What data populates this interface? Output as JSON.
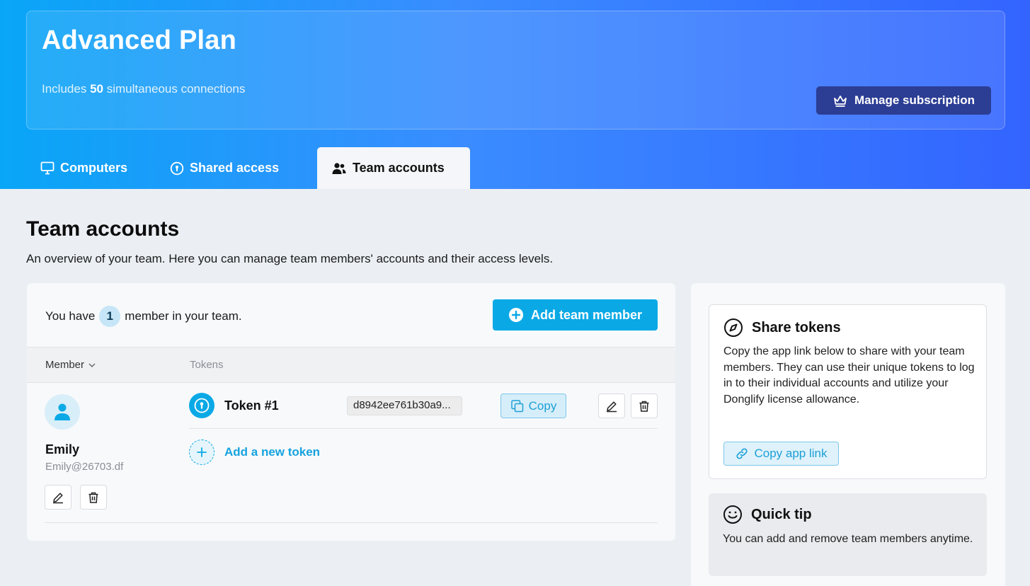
{
  "plan": {
    "title": "Advanced Plan",
    "sub_prefix": "Includes",
    "connections": "50",
    "sub_suffix": "simultaneous connections",
    "manage_label": "Manage subscription"
  },
  "tabs": [
    {
      "label": "Computers",
      "icon": "monitor-icon",
      "active": false
    },
    {
      "label": "Shared access",
      "icon": "keyhole-icon",
      "active": false
    },
    {
      "label": "Team accounts",
      "icon": "users-icon",
      "active": true
    }
  ],
  "page": {
    "title": "Team accounts",
    "description": "An overview of your team. Here you can manage team members' accounts and their access levels."
  },
  "team": {
    "count_prefix": "You have",
    "count": "1",
    "count_suffix": "member in your team.",
    "add_member_label": "Add team member",
    "columns": {
      "member": "Member",
      "tokens": "Tokens"
    },
    "members": [
      {
        "name": "Emily",
        "email": "Emily@26703.df",
        "tokens": [
          {
            "name": "Token #1",
            "value": "d8942ee761b30a9...",
            "copy_label": "Copy"
          }
        ],
        "add_token_label": "Add a new token"
      }
    ]
  },
  "share": {
    "title": "Share tokens",
    "text": "Copy the app link below to share with your team members. They can use their unique tokens to log in to their individual accounts and utilize your Donglify license allowance.",
    "button_label": "Copy app link"
  },
  "tip": {
    "title": "Quick tip",
    "text": "You can add and remove team members anytime."
  },
  "colors": {
    "accent": "#0aa9e6",
    "manage_button": "#2c3d94",
    "gradient_start": "#09a6f7",
    "gradient_end": "#3364ff"
  }
}
